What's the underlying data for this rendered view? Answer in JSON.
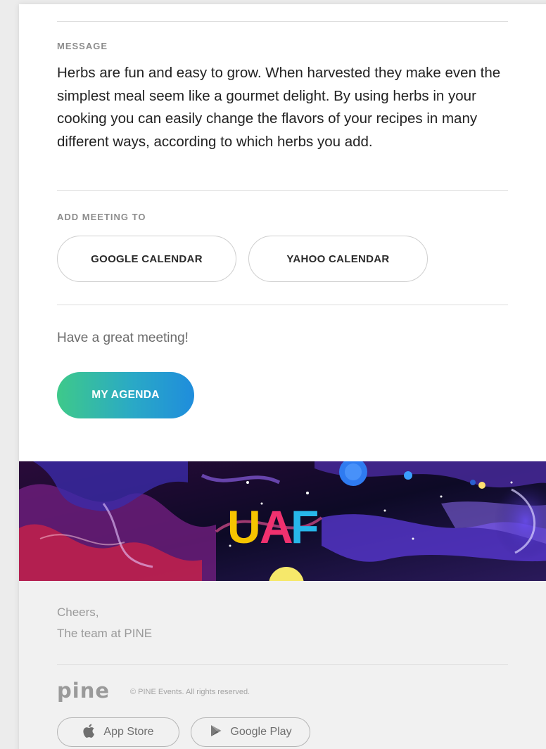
{
  "message": {
    "label": "MESSAGE",
    "body": "Herbs are fun and easy to grow. When harvested they make even the simplest meal seem like a gourmet delight. By using herbs in your cooking you can easily change the flavors of your recipes in many different ways, according to which herbs you add."
  },
  "calendar": {
    "label": "ADD MEETING TO",
    "google": "GOOGLE CALENDAR",
    "yahoo": "YAHOO CALENDAR"
  },
  "greeting": "Have a great meeting!",
  "agenda_button": "MY AGENDA",
  "banner": {
    "logo_letters": [
      "U",
      "A",
      "F"
    ],
    "logo_colors": [
      "#f6c400",
      "#f0316f",
      "#27b7ea"
    ]
  },
  "footer": {
    "cheers": "Cheers,",
    "team": "The team at PINE",
    "brand": "pine",
    "copyright": "© PINE Events. All rights reserved.",
    "app_store": "App Store",
    "google_play": "Google Play",
    "app_store_icon": "apple-icon",
    "google_play_icon": "play-icon"
  },
  "colors": {
    "accent_gradient_start": "#3ec98a",
    "accent_gradient_end": "#1f8ddc"
  }
}
